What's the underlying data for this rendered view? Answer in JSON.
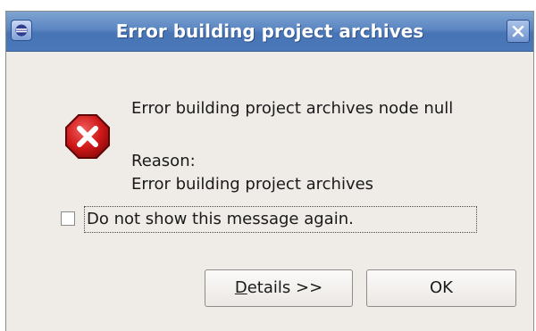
{
  "window": {
    "title": "Error building project archives"
  },
  "message": {
    "main": "Error building project archives node null",
    "reason_label": "Reason:",
    "reason_text": "Error building project archives"
  },
  "checkbox": {
    "label": "Do not show this message again.",
    "checked": false
  },
  "buttons": {
    "details_mnemonic": "D",
    "details_rest": "etails >>",
    "ok": "OK"
  },
  "colors": {
    "titlebar": "#4a78b8",
    "dialog_bg": "#efebe7",
    "error_red": "#d01818"
  },
  "icons": {
    "app": "eclipse-app-icon",
    "close": "close-icon",
    "error": "error-icon",
    "checkbox": "checkbox-icon"
  }
}
